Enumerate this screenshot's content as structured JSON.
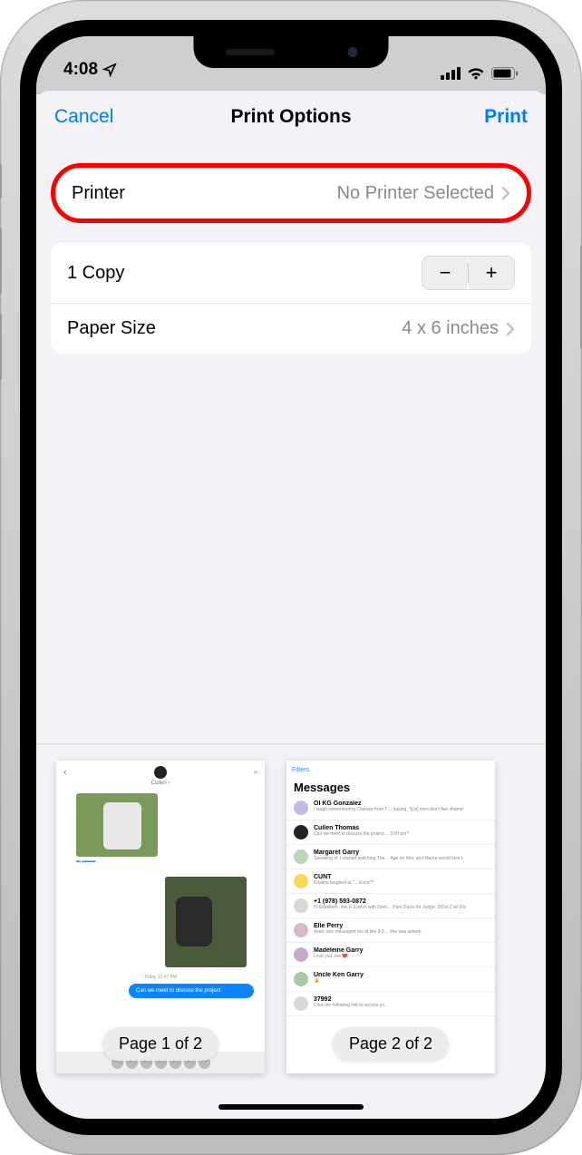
{
  "status": {
    "time": "4:08"
  },
  "nav": {
    "cancel": "Cancel",
    "title": "Print Options",
    "print": "Print"
  },
  "printer": {
    "label": "Printer",
    "value": "No Printer Selected"
  },
  "copies": {
    "label": "1 Copy"
  },
  "paper": {
    "label": "Paper Size",
    "value": "4 x 6 inches"
  },
  "pages": {
    "page1": "Page 1 of 2",
    "page2": "Page 2 of 2"
  },
  "thumb2": {
    "filters": "Filters",
    "title": "Messages",
    "rows": [
      {
        "n": "OI KG Gonzalez",
        "s": "I laugh remembering Chelsea from T… saying, \"[cis] men don't feel shame\""
      },
      {
        "n": "Cullen Thomas",
        "s": "Can we meet to discuss the project… 3:00 pm?"
      },
      {
        "n": "Margaret Garry",
        "s": "Speaking of, I started watching The… Age on hbo, and Mama would love t"
      },
      {
        "n": "CUNT",
        "s": "Kristina laughed at \"…iconic?\""
      },
      {
        "n": "+1 (978) 593-0872",
        "s": "Hi Elisabeth, this is Evelyn with Dem… Pam Davis for Judge, 281st Civil Dis"
      },
      {
        "n": "Elle Perry",
        "s": "Yeah, she messaged me at like 8:3… she was asleep"
      },
      {
        "n": "Madeleine Garry",
        "s": "Love you, too ❤️"
      },
      {
        "n": "Uncle Ken Garry",
        "s": "👍"
      },
      {
        "n": "37992",
        "s": "Click the following link to access yo…"
      }
    ]
  },
  "thumb1": {
    "bubble": "Can we meet to discuss the project"
  }
}
